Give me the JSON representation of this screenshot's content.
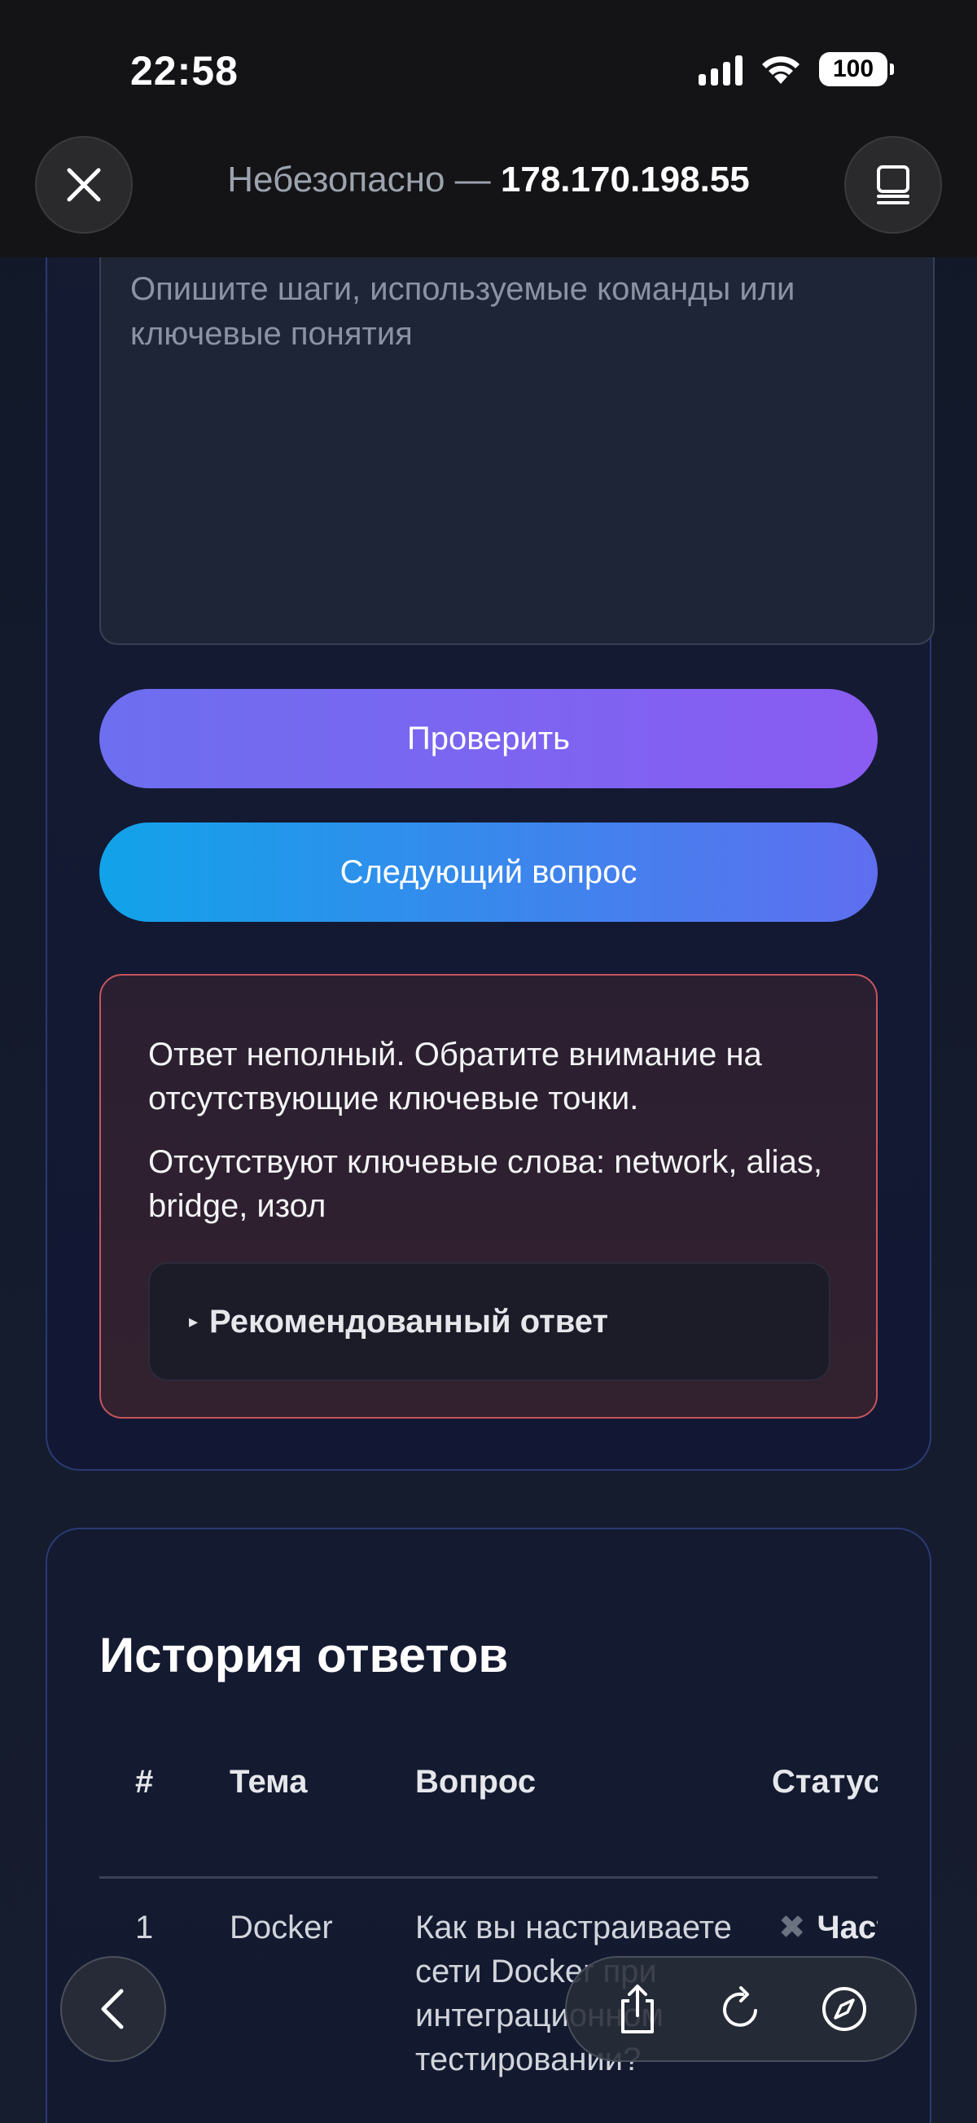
{
  "status_bar": {
    "time": "22:58",
    "battery": "100"
  },
  "browser": {
    "url_prefix": "Небезопасно — ",
    "url_host": "178.170.198.55"
  },
  "question_card": {
    "answer_placeholder": "Опишите шаги, используемые команды или ключевые понятия",
    "check_button": "Проверить",
    "next_button": "Следующий вопрос",
    "feedback": {
      "summary": "Ответ неполный. Обратите внимание на отсутствующие ключевые точки.",
      "missing": "Отсутствуют ключевые слова: network, alias, bridge, изол",
      "recommended_toggle": "Рекомендованный ответ"
    }
  },
  "history": {
    "title": "История ответов",
    "columns": [
      "#",
      "Тема",
      "Вопрос",
      "Статус"
    ],
    "rows": [
      {
        "num": "1",
        "topic": "Docker",
        "question": "Как вы настраиваете сети Docker при интеграционном тестировании?",
        "status": "Частично"
      }
    ]
  },
  "colors": {
    "accent_purple": "#8a5cf2",
    "accent_blue": "#11a3e9",
    "error_border": "#c6555d"
  },
  "icons": {
    "close": "close-icon",
    "tabs": "tabs-icon",
    "back": "chevron-left-icon",
    "share": "share-icon",
    "reload": "reload-icon",
    "compass": "compass-icon"
  }
}
